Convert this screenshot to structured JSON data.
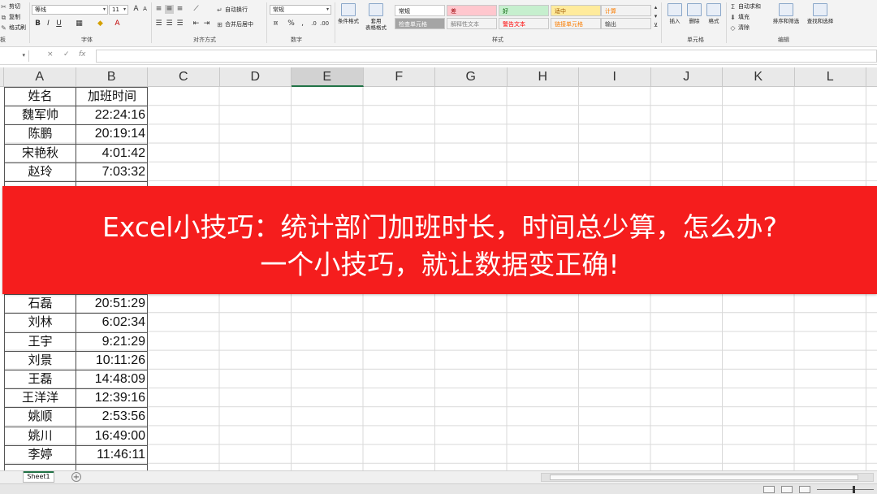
{
  "ribbon": {
    "clipboard": {
      "cut": "剪切",
      "copy": "复制",
      "format_painter": "格式刷",
      "group_label": "板"
    },
    "font": {
      "font_name": "等线",
      "font_size": "11",
      "group_label": "字体",
      "bold": "B",
      "italic": "I",
      "underline": "U"
    },
    "alignment": {
      "wrap_text": "自动换行",
      "merge_center": "合并后居中",
      "group_label": "对齐方式"
    },
    "number": {
      "format": "常规",
      "percent": "%",
      "group_label": "数字"
    },
    "styles": {
      "conditional_formatting": "条件格式",
      "format_as_table_line1": "套用",
      "format_as_table_line2": "表格格式",
      "cells": [
        {
          "label": "常规",
          "bg": "#ffffff",
          "color": "#111111"
        },
        {
          "label": "差",
          "bg": "#ffc7ce",
          "color": "#9c0006"
        },
        {
          "label": "好",
          "bg": "#c6efce",
          "color": "#006100"
        },
        {
          "label": "适中",
          "bg": "#ffeb9c",
          "color": "#9c5700"
        },
        {
          "label": "计算",
          "bg": "#f2f2f2",
          "color": "#fa7d00"
        },
        {
          "label": "检查单元格",
          "bg": "#a5a5a5",
          "color": "#ffffff"
        },
        {
          "label": "解释性文本",
          "bg": "#f3f3f3",
          "color": "#7f7f7f"
        },
        {
          "label": "警告文本",
          "bg": "#f3f3f3",
          "color": "#ff0000"
        },
        {
          "label": "链接单元格",
          "bg": "#f3f3f3",
          "color": "#fa7d00"
        },
        {
          "label": "输出",
          "bg": "#f2f2f2",
          "color": "#3f3f3f"
        }
      ],
      "group_label": "样式"
    },
    "cells_group": {
      "insert": "插入",
      "delete": "删除",
      "format": "格式",
      "group_label": "单元格"
    },
    "editing": {
      "autosum": "自动求和",
      "fill": "填充",
      "clear": "清除",
      "sort_filter": "排序和筛选",
      "find_select": "查找和选择",
      "group_label": "编辑"
    }
  },
  "formula_bar": {
    "cancel": "×",
    "enter": "✓",
    "fx": "fx"
  },
  "grid": {
    "columns": [
      "A",
      "B",
      "C",
      "D",
      "E",
      "F",
      "G",
      "H",
      "I",
      "J",
      "K",
      "L"
    ],
    "selected_column": "E",
    "header_row": {
      "name": "姓名",
      "time": "加班时间"
    },
    "rows_top": [
      {
        "name": "魏军帅",
        "time": "22:24:16"
      },
      {
        "name": "陈鹏",
        "time": "20:19:14"
      },
      {
        "name": "宋艳秋",
        "time": "4:01:42"
      },
      {
        "name": "赵玲",
        "time": "7:03:32"
      }
    ],
    "rows_bottom": [
      {
        "name": "石磊",
        "time": "20:51:29"
      },
      {
        "name": "刘林",
        "time": "6:02:34"
      },
      {
        "name": "王宇",
        "time": "9:21:29"
      },
      {
        "name": "刘景",
        "time": "10:11:26"
      },
      {
        "name": "王磊",
        "time": "14:48:09"
      },
      {
        "name": "王洋洋",
        "time": "12:39:16"
      },
      {
        "name": "姚顺",
        "time": "2:53:56"
      },
      {
        "name": "姚川",
        "time": "16:49:00"
      },
      {
        "name": "李婷",
        "time": "11:46:11"
      }
    ]
  },
  "sheet_tabs": {
    "active": "Sheet1",
    "add": "+"
  },
  "banner": {
    "line1": "Excel小技巧：统计部门加班时长，时间总少算，怎么办?",
    "line2": "一个小技巧，就让数据变正确!",
    "bg_color": "#f51d1d"
  }
}
